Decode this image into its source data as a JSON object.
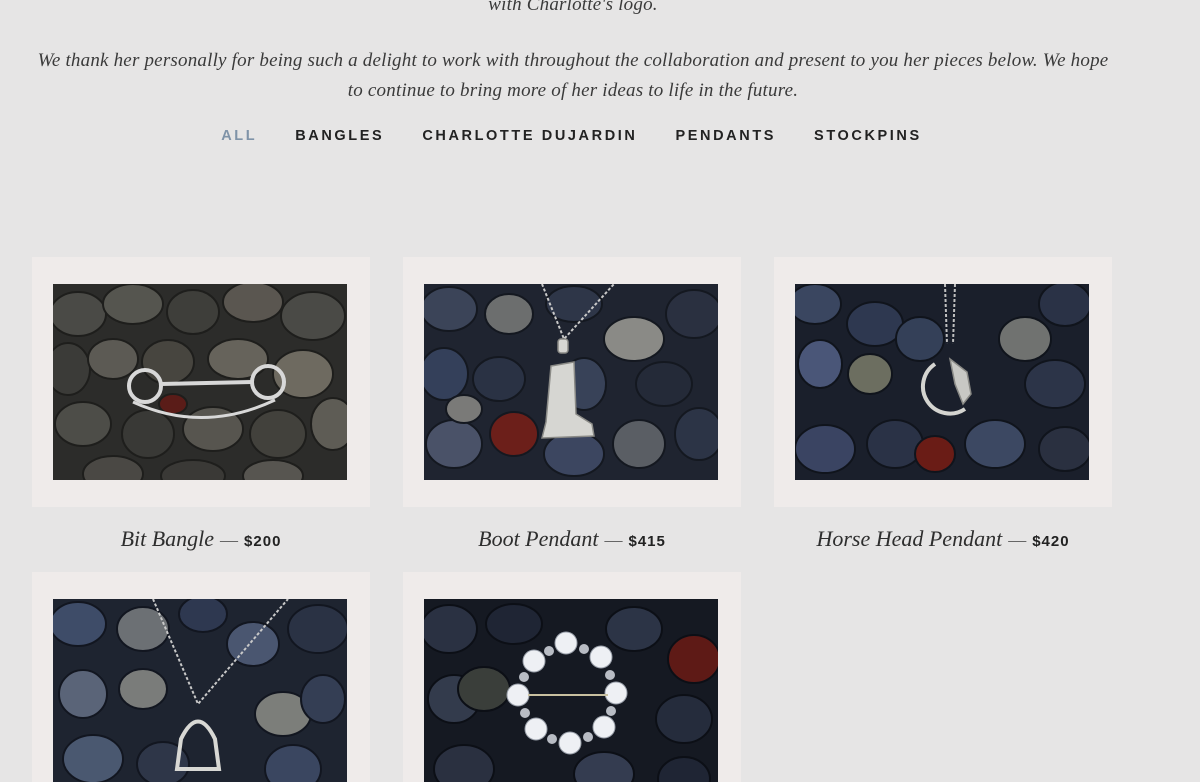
{
  "intro": {
    "line_top": "with Charlotte's logo.",
    "line_1": "We thank her personally for being such a delight to work with throughout the collaboration and present to you her pieces below. We hope",
    "line_2": "to continue to bring more of her ideas to life in the future."
  },
  "filters": [
    {
      "label": "ALL",
      "active": true
    },
    {
      "label": "BANGLES",
      "active": false
    },
    {
      "label": "CHARLOTTE DUJARDIN",
      "active": false
    },
    {
      "label": "PENDANTS",
      "active": false
    },
    {
      "label": "STOCKPINS",
      "active": false
    }
  ],
  "products": [
    {
      "name": "Bit Bangle",
      "separator": "—",
      "price": "$200",
      "icon": "bit-bangle-photo"
    },
    {
      "name": "Boot Pendant",
      "separator": "—",
      "price": "$415",
      "icon": "boot-pendant-photo"
    },
    {
      "name": "Horse Head Pendant",
      "separator": "—",
      "price": "$420",
      "icon": "horse-head-pendant-photo"
    },
    {
      "name": "",
      "price": "",
      "icon": "stirrup-pendant-photo"
    },
    {
      "name": "",
      "price": "",
      "icon": "pearl-stock-pin-photo"
    }
  ],
  "colors": {
    "page_background": "#e6e5e5",
    "card_background": "#efebea",
    "active_filter": "#7f93a8",
    "text": "#222222"
  }
}
